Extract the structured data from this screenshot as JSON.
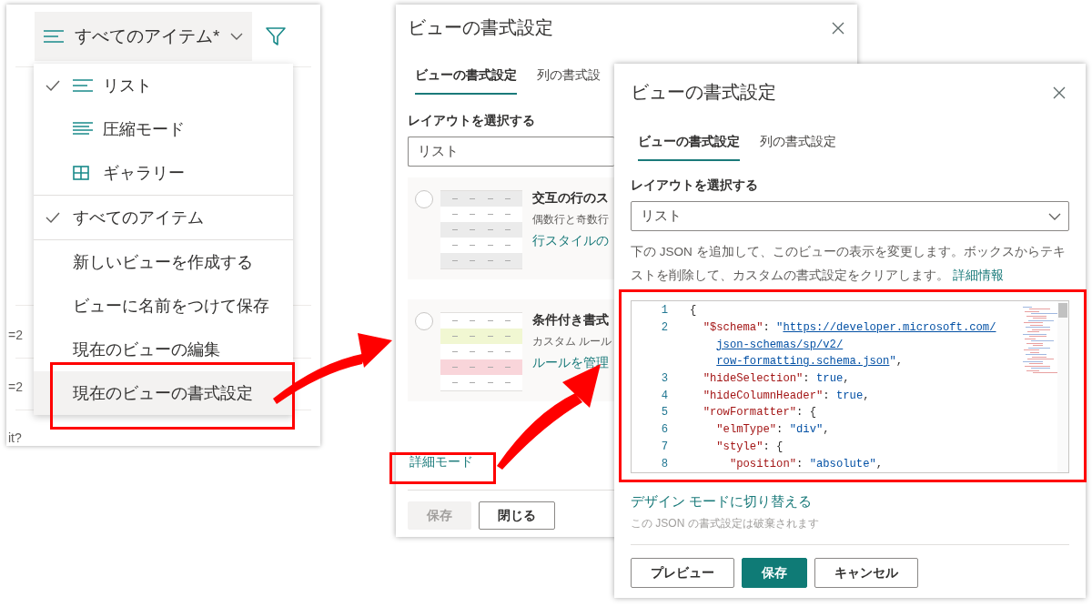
{
  "view_menu": {
    "current_view": "すべてのアイテム*",
    "layouts": [
      {
        "label": "リスト",
        "selected": true
      },
      {
        "label": "圧縮モード",
        "selected": false
      },
      {
        "label": "ギャラリー",
        "selected": false
      }
    ],
    "views": [
      {
        "label": "すべてのアイテム",
        "selected": true
      }
    ],
    "actions": [
      {
        "label": "新しいビューを作成する",
        "highlighted": false
      },
      {
        "label": "ビューに名前をつけて保存",
        "highlighted": false
      },
      {
        "label": "現在のビューの編集",
        "highlighted": false
      },
      {
        "label": "現在のビューの書式設定",
        "highlighted": true
      }
    ],
    "background_fragments": [
      "=2",
      "=2",
      "it?"
    ]
  },
  "design_panel": {
    "title": "ビューの書式設定",
    "tabs": [
      {
        "label": "ビューの書式設定",
        "selected": true
      },
      {
        "label": "列の書式設",
        "selected": false
      }
    ],
    "layout_label": "レイアウトを選択する",
    "layout_value": "リスト",
    "options": [
      {
        "kind": "alternating",
        "title": "交互の行のス",
        "description": "偶数行と奇数行",
        "link": "行スタイルの",
        "selected": false
      },
      {
        "kind": "conditional",
        "title": "条件付き書式",
        "description": "カスタム ルール",
        "link": "ルールを管理",
        "selected": false
      }
    ],
    "advanced_link": "詳細モード",
    "buttons": [
      {
        "label": "保存",
        "kind": "primary",
        "disabled": true
      },
      {
        "label": "閉じる",
        "kind": "default",
        "disabled": false
      }
    ]
  },
  "advanced_panel": {
    "title": "ビューの書式設定",
    "tabs": [
      {
        "label": "ビューの書式設定",
        "selected": true
      },
      {
        "label": "列の書式設定",
        "selected": false
      }
    ],
    "layout_label": "レイアウトを選択する",
    "layout_value": "リスト",
    "description": "下の JSON を追加して、このビューの表示を変更します。ボックスからテキストを削除して、カスタムの書式設定をクリアします。",
    "description_link": "詳細情報",
    "code_lines": [
      {
        "number": "1",
        "tokens": [
          {
            "kind": "punct",
            "text": "{"
          }
        ]
      },
      {
        "number": "2",
        "tokens": [
          {
            "kind": "key",
            "text": "  \"$schema\""
          },
          {
            "kind": "punct",
            "text": ": "
          },
          {
            "kind": "string",
            "text": "\""
          },
          {
            "kind": "link",
            "text": "https://developer.microsoft.com/"
          }
        ]
      },
      {
        "tokens": [
          {
            "kind": "link",
            "text": "    json-schemas/sp/v2/"
          }
        ]
      },
      {
        "tokens": [
          {
            "kind": "link",
            "text": "    row-formatting.schema.json"
          },
          {
            "kind": "string",
            "text": "\""
          },
          {
            "kind": "punct",
            "text": ","
          }
        ]
      },
      {
        "number": "3",
        "tokens": [
          {
            "kind": "key",
            "text": "  \"hideSelection\""
          },
          {
            "kind": "punct",
            "text": ": "
          },
          {
            "kind": "keyword",
            "text": "true"
          },
          {
            "kind": "punct",
            "text": ","
          }
        ]
      },
      {
        "number": "4",
        "tokens": [
          {
            "kind": "key",
            "text": "  \"hideColumnHeader\""
          },
          {
            "kind": "punct",
            "text": ": "
          },
          {
            "kind": "keyword",
            "text": "true"
          },
          {
            "kind": "punct",
            "text": ","
          }
        ]
      },
      {
        "number": "5",
        "tokens": [
          {
            "kind": "key",
            "text": "  \"rowFormatter\""
          },
          {
            "kind": "punct",
            "text": ": {"
          }
        ]
      },
      {
        "number": "6",
        "tokens": [
          {
            "kind": "key",
            "text": "    \"elmType\""
          },
          {
            "kind": "punct",
            "text": ": "
          },
          {
            "kind": "string",
            "text": "\"div\""
          },
          {
            "kind": "punct",
            "text": ","
          }
        ]
      },
      {
        "number": "7",
        "tokens": [
          {
            "kind": "key",
            "text": "    \"style\""
          },
          {
            "kind": "punct",
            "text": ": {"
          }
        ]
      },
      {
        "number": "8",
        "tokens": [
          {
            "kind": "key",
            "text": "      \"position\""
          },
          {
            "kind": "punct",
            "text": ": "
          },
          {
            "kind": "string",
            "text": "\"absolute\""
          },
          {
            "kind": "punct",
            "text": ","
          }
        ]
      }
    ],
    "switch_link": "デザイン モードに切り替える",
    "note": "この JSON の書式設定は破棄されます",
    "buttons": [
      {
        "label": "プレビュー",
        "kind": "default",
        "disabled": false
      },
      {
        "label": "保存",
        "kind": "primary",
        "disabled": false
      },
      {
        "label": "キャンセル",
        "kind": "default",
        "disabled": false
      }
    ]
  }
}
